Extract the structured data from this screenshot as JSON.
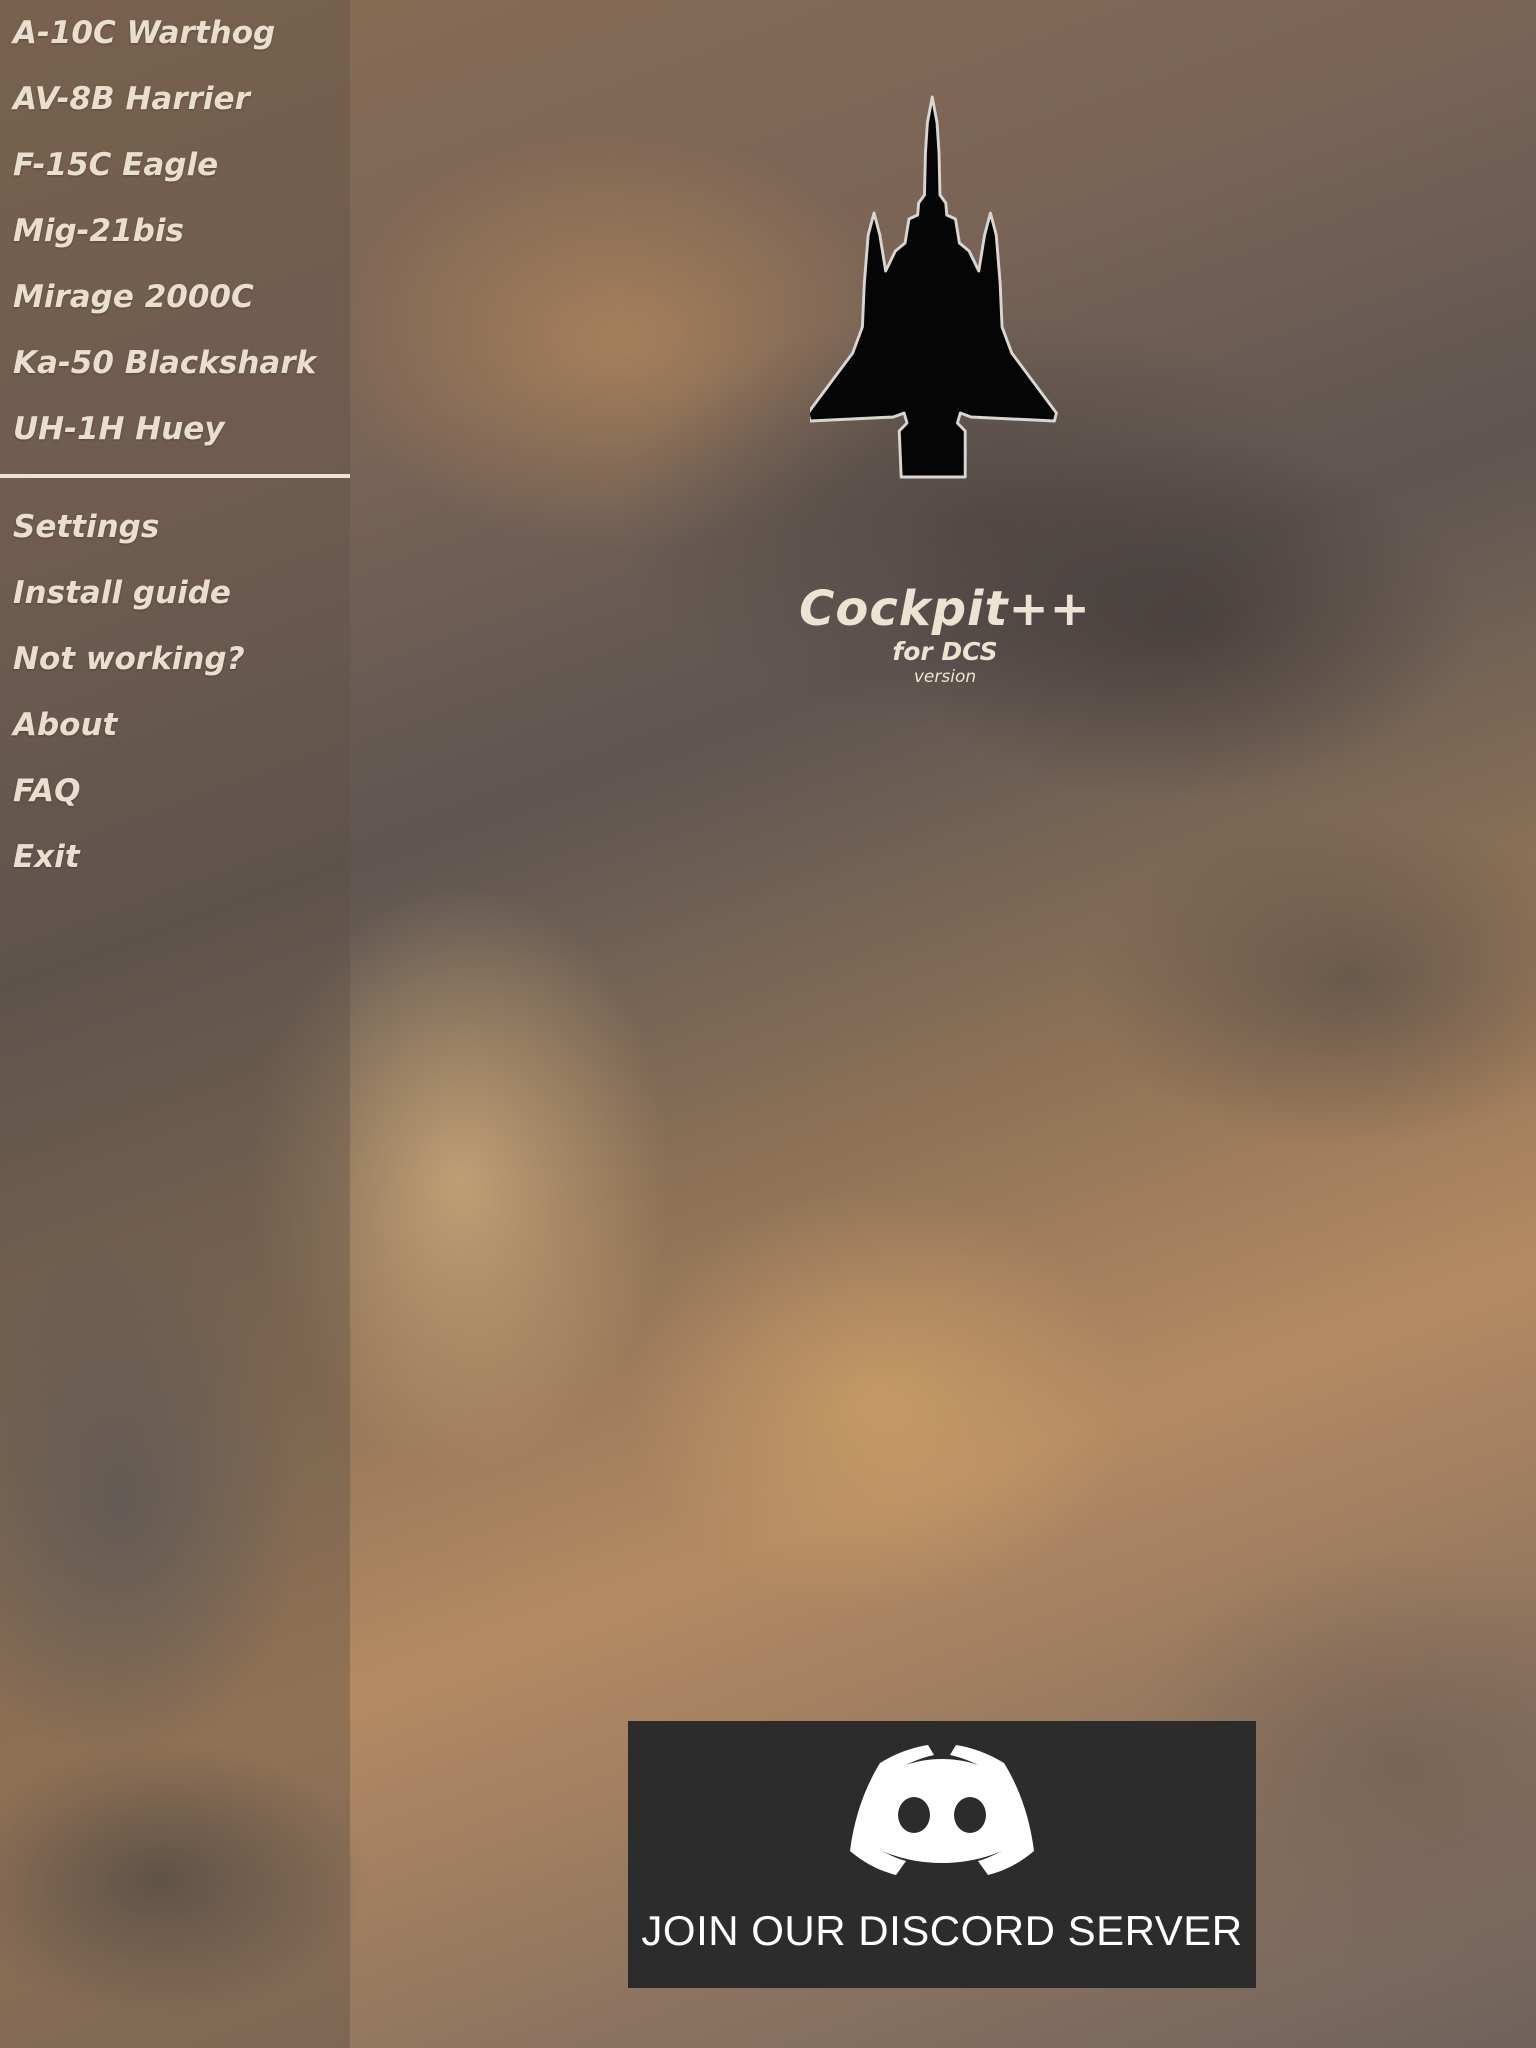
{
  "sidebar": {
    "aircraft": [
      {
        "label": "A-10C Warthog"
      },
      {
        "label": "AV-8B Harrier"
      },
      {
        "label": "F-15C Eagle"
      },
      {
        "label": "Mig-21bis"
      },
      {
        "label": "Mirage 2000C"
      },
      {
        "label": "Ka-50 Blackshark"
      },
      {
        "label": "UH-1H Huey"
      }
    ],
    "options": [
      {
        "label": "Settings"
      },
      {
        "label": "Install guide"
      },
      {
        "label": "Not working?"
      },
      {
        "label": "About"
      },
      {
        "label": "FAQ"
      },
      {
        "label": "Exit"
      }
    ]
  },
  "header": {
    "logo_icon": "jet-silhouette-icon",
    "title": "Cockpit++",
    "subtitle": "for DCS",
    "version": "version"
  },
  "discord": {
    "icon": "discord-logo-icon",
    "label": "JOIN OUR DISCORD SERVER"
  },
  "colors": {
    "menu_text": "#eadfce",
    "divider": "#ece3d3",
    "discord_bg": "#2c2c2c",
    "discord_text": "#ffffff"
  }
}
